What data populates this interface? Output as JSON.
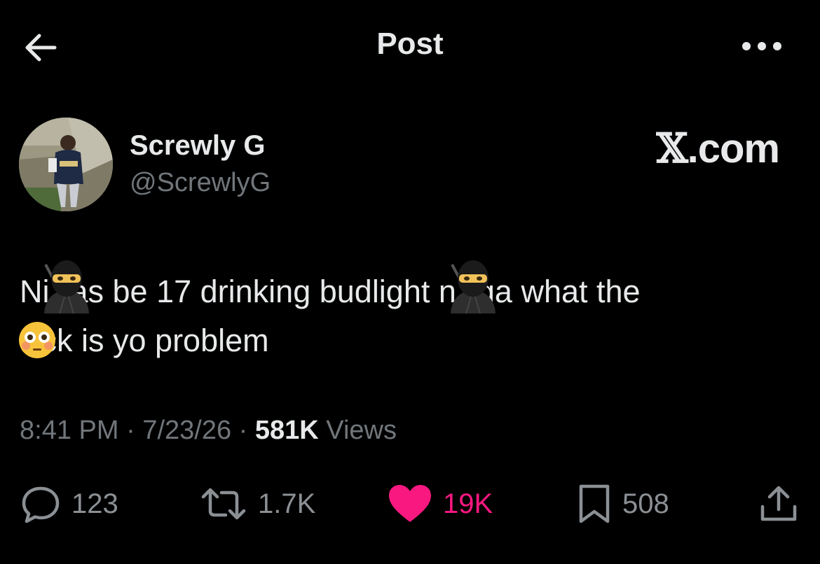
{
  "header": {
    "title": "Post"
  },
  "author": {
    "name": "Screwly G",
    "handle": "@ScrewlyG"
  },
  "brand": {
    "mark": "𝕏",
    "text": ".com"
  },
  "tweet": {
    "line1_part1": "Ni",
    "line1_part2": "as be 17 drinking budlight n",
    "line1_part3": "ga what the",
    "line2_part1": "f",
    "line2_part2": "ck is yo problem",
    "emojis": [
      "ninja-emoji",
      "ninja-emoji",
      "flushed-face-emoji"
    ]
  },
  "meta": {
    "time": "8:41 PM",
    "separator": "·",
    "date": "7/23/26",
    "views_count": "581K",
    "views_label": "Views"
  },
  "actions": {
    "reply_count": "123",
    "repost_count": "1.7K",
    "like_count": "19K",
    "bookmark_count": "508"
  },
  "icons": {
    "back": "arrow-left-icon",
    "more": "more-horizontal-icon",
    "reply": "speech-bubble-icon",
    "repost": "repost-arrows-icon",
    "like": "heart-icon",
    "bookmark": "bookmark-icon",
    "share": "share-upload-icon"
  },
  "colors": {
    "background": "#000000",
    "text": "#e7e9ea",
    "secondary": "#71767b",
    "like": "#f91880"
  }
}
